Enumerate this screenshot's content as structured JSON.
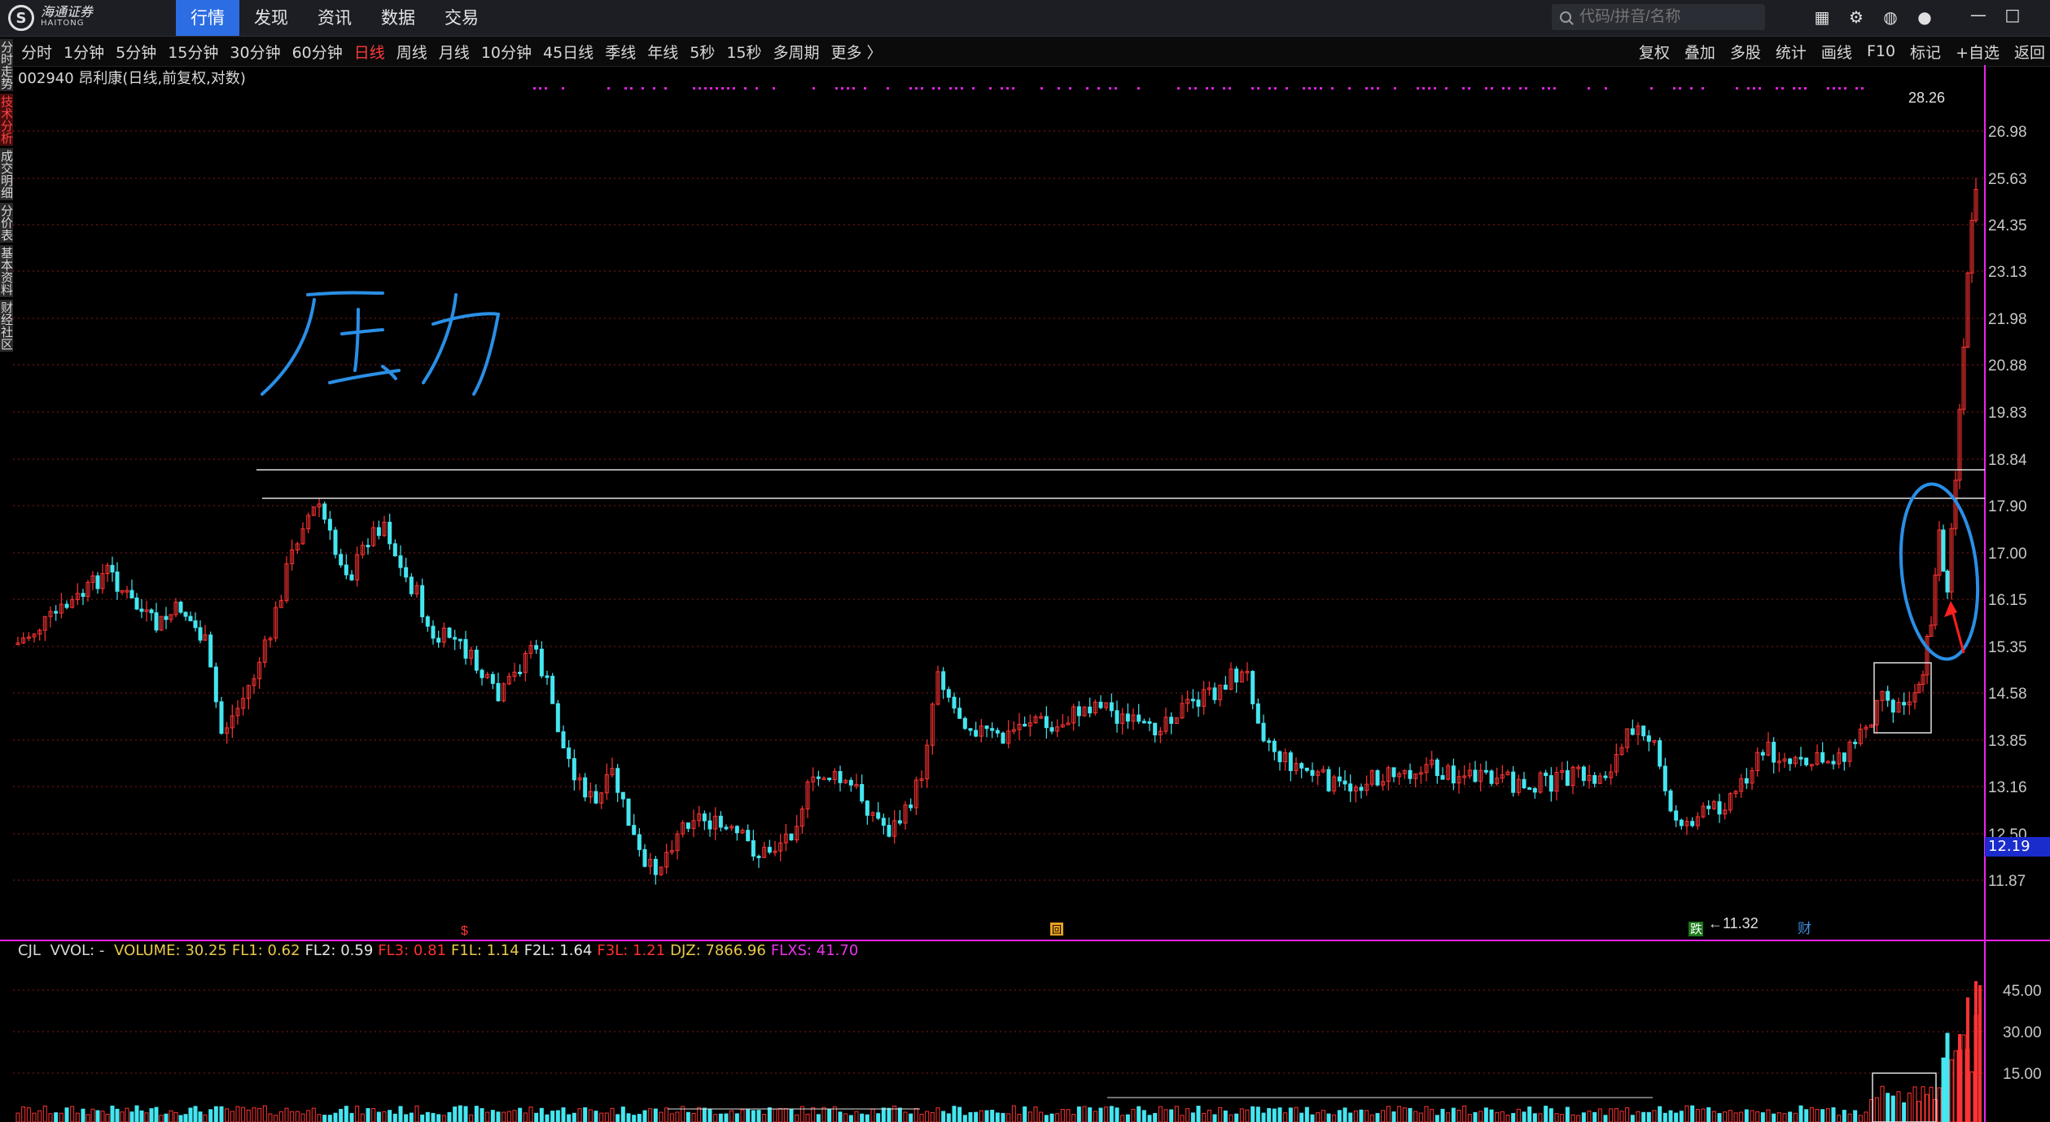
{
  "app": {
    "logo_cn": "海通证券",
    "logo_en": "HAITONG",
    "logo_mark": "S"
  },
  "menu": [
    "行情",
    "发现",
    "资讯",
    "数据",
    "交易"
  ],
  "search": {
    "placeholder": "代码/拼音/名称"
  },
  "top_icons": [
    "grid-icon",
    "gear-icon",
    "globe-icon",
    "chat-icon"
  ],
  "window_controls": [
    "—",
    "□"
  ],
  "periods": [
    "分时",
    "1分钟",
    "5分钟",
    "15分钟",
    "30分钟",
    "60分钟",
    "日线",
    "周线",
    "月线",
    "10分钟",
    "45日线",
    "季线",
    "年线",
    "5秒",
    "15秒",
    "多周期",
    "更多 〉"
  ],
  "active_period": "日线",
  "right_tools": [
    "复权",
    "叠加",
    "多股",
    "统计",
    "画线",
    "F10",
    "标记",
    "+自选",
    "返回"
  ],
  "side_tabs": [
    "分时走势",
    "技术分析",
    "成交明细",
    "分价表",
    "基本资料",
    "财经社区"
  ],
  "stock": {
    "title": "002940 昂利康(日线,前复权,对数)"
  },
  "price_axis": [
    "26.98",
    "25.63",
    "24.35",
    "23.13",
    "21.98",
    "20.88",
    "19.83",
    "18.84",
    "17.90",
    "17.00",
    "16.15",
    "15.35",
    "14.58",
    "13.85",
    "13.16",
    "12.50",
    "11.87"
  ],
  "high_label": "28.26",
  "low_label": "←11.32",
  "current_price": "12.19",
  "handwriting": "压力",
  "markers": {
    "fall": "跌",
    "finance": "财",
    "dollar": "$",
    "box": "回"
  },
  "volume_header": {
    "name": "CJL",
    "vvol": "VVOL: -",
    "items": [
      {
        "label": "VOLUME: 30.25",
        "color": "#e8c84a"
      },
      {
        "label": "FL1: 0.62",
        "color": "#e8c84a"
      },
      {
        "label": "FL2: 0.59",
        "color": "#e6e6e6"
      },
      {
        "label": "FL3: 0.81",
        "color": "#ff3030"
      },
      {
        "label": "F1L: 1.14",
        "color": "#e8c84a"
      },
      {
        "label": "F2L: 1.64",
        "color": "#e6e6e6"
      },
      {
        "label": "F3L: 1.21",
        "color": "#ff3030"
      },
      {
        "label": "DJZ: 7866.96",
        "color": "#e8c84a"
      },
      {
        "label": "FLXS: 41.70",
        "color": "#ee33ee"
      }
    ]
  },
  "volume_axis": [
    "45.00",
    "30.00",
    "15.00"
  ],
  "colors": {
    "up": "#ff3333",
    "down": "#44e6f0",
    "grid": "#8a1a1a",
    "ink": "#2a8fe6",
    "magenta": "#dd22dd"
  }
}
